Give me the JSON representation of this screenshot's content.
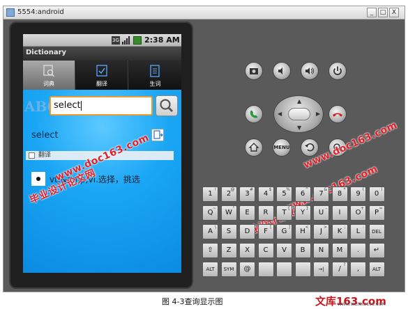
{
  "window": {
    "title": "5554:android",
    "min_label": "_",
    "max_label": "□",
    "close_label": "X"
  },
  "status": {
    "network": "3G",
    "time": "2:38 AM"
  },
  "app": {
    "title": "Dictionary"
  },
  "tabs": [
    {
      "label": "词典",
      "active": true
    },
    {
      "label": "翻译",
      "active": false
    },
    {
      "label": "生词",
      "active": false
    }
  ],
  "search": {
    "value": "select",
    "decor_text": "ABC"
  },
  "result": {
    "word": "select",
    "section_label": "翻译",
    "definition": "vt.&amp;vi.选择，挑选"
  },
  "controls": {
    "menu_label": "MENU"
  },
  "keyboard": {
    "rows": [
      [
        [
          "1",
          "!"
        ],
        [
          "2",
          "@"
        ],
        [
          "3",
          "#"
        ],
        [
          "4",
          "$"
        ],
        [
          "5",
          "%"
        ],
        [
          "6",
          "^"
        ],
        [
          "7",
          "&"
        ],
        [
          "8",
          "*"
        ],
        [
          "9",
          "("
        ],
        [
          "0",
          ")"
        ]
      ],
      [
        [
          "Q",
          "~"
        ],
        [
          "W",
          "\""
        ],
        [
          "E",
          ""
        ],
        [
          "R",
          ""
        ],
        [
          "T",
          "{"
        ],
        [
          "Y",
          "}"
        ],
        [
          "U",
          "-"
        ],
        [
          "I",
          ""
        ],
        [
          "O",
          "+"
        ],
        [
          "P",
          "="
        ]
      ],
      [
        [
          "A",
          "\\"
        ],
        [
          "S",
          ""
        ],
        [
          "D",
          ""
        ],
        [
          "F",
          "["
        ],
        [
          "G",
          "]"
        ],
        [
          "H",
          "<"
        ],
        [
          "J",
          ">"
        ],
        [
          "K",
          ";"
        ],
        [
          "L",
          ":"
        ],
        [
          "DEL",
          ""
        ]
      ],
      [
        [
          "⇧",
          ""
        ],
        [
          "Z",
          ""
        ],
        [
          "X",
          ""
        ],
        [
          "C",
          ""
        ],
        [
          "V",
          ""
        ],
        [
          "B",
          ""
        ],
        [
          "N",
          ""
        ],
        [
          "M",
          ""
        ],
        [
          ".",
          ""
        ],
        [
          "↵",
          ""
        ]
      ],
      [
        [
          "ALT",
          ""
        ],
        [
          "SYM",
          ""
        ],
        [
          "@",
          ""
        ],
        [
          "",
          ""
        ],
        [
          "",
          ""
        ],
        [
          "",
          ""
        ],
        [
          "→|",
          ""
        ],
        [
          "/",
          "?"
        ],
        [
          ",",
          ""
        ],
        [
          "ALT",
          ""
        ]
      ]
    ]
  },
  "watermarks": [
    "毕业设计论文网",
    "www.doc163.com"
  ],
  "caption": "图 4-3查询显示图",
  "logo": {
    "text": "文库163.com",
    "sub": "WWW.WENKU163.COM"
  }
}
